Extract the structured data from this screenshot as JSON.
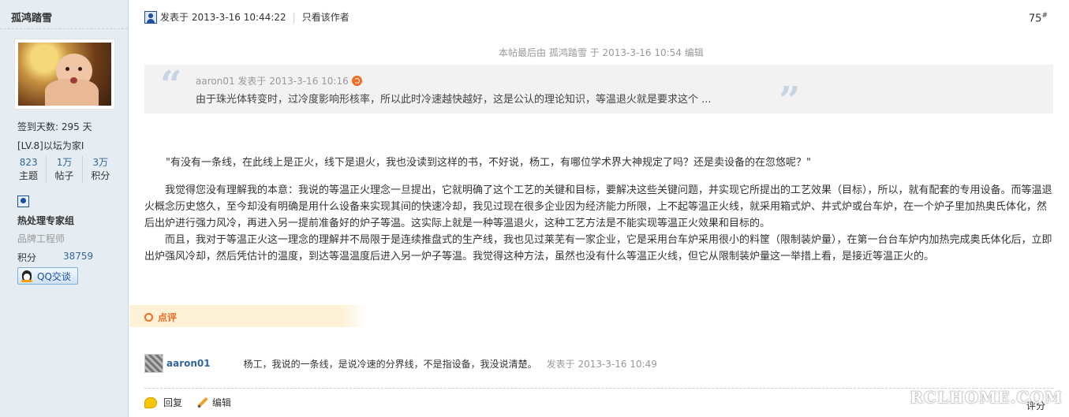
{
  "sidebar": {
    "username": "孤鸿踏雪",
    "checkin_days": "签到天数: 295 天",
    "level": "[LV.8]以坛为家I",
    "counts": [
      {
        "num": "823",
        "label": "主题"
      },
      {
        "num": "1万",
        "label": "帖子"
      },
      {
        "num": "3万",
        "label": "积分"
      }
    ],
    "group_name": "热处理专家组",
    "group_title": "品牌工程师",
    "score_label": "积分",
    "score_value": "38759",
    "qq_label": "QQ交谈"
  },
  "post": {
    "posted_at": "发表于 2013-3-16 10:44:22",
    "only_author": "只看该作者",
    "floor": "75",
    "floor_mark": "#",
    "edit_note": "本帖最后由 孤鸿踏雪 于 2013-3-16 10:54 编辑",
    "quote": {
      "header": "aaron01 发表于 2013-3-16 10:16",
      "body": "由于珠光体转变时，过冷度影响形核率，所以此时冷速越快越好，这是公认的理论知识，等温退火就是要求这个 ..."
    },
    "paragraphs": [
      "\"有没有一条线，在此线上是正火，线下是退火，我也没读到这样的书，不好说，杨工，有哪位学术界大神规定了吗？还是卖设备的在忽悠呢？\"",
      "我觉得您没有理解我的本意：我说的等温正火理念一旦提出，它就明确了这个工艺的关键和目标，要解决这些关键问题，并实现它所提出的工艺效果（目标），所以，就有配套的专用设备。而等温退火概念历史悠久，至今却没有明确是用什么设备来实现其间的快速冷却，我见过现在很多企业因为经济能力所限，上不起等温正火线，就采用箱式炉、井式炉或台车炉，在一个炉子里加热奥氏体化，然后出炉进行强力风冷，再进入另一提前准备好的炉子等温。这实际上就是一种等温退火，这种工艺方法是不能实现等温正火效果和目标的。",
      "而且，我对于等温正火这一理念的理解并不局限于是连续推盘式的生产线，我也见过莱芜有一家企业，它是采用台车炉采用很小的料筐（限制装炉量），在第一台台车炉内加热完成奥氏体化后，立即出炉强风冷却，然后凭估计的温度，到达等温温度后进入另一炉子等温。我觉得这种方法，虽然也没有什么等温正火线，但它从限制装炉量这一举措上看，是接近等温正火的。"
    ]
  },
  "comments": {
    "tab_label": "点评",
    "items": [
      {
        "user": "aaron01",
        "text": "杨工，我说的一条线，是说冷速的分界线，不是指设备，我没说清楚。",
        "time": "发表于 2013-3-16 10:49"
      }
    ]
  },
  "actions": {
    "reply": "回复",
    "edit": "编辑",
    "rate": "评分"
  },
  "watermark": "RCLHOME.COM"
}
